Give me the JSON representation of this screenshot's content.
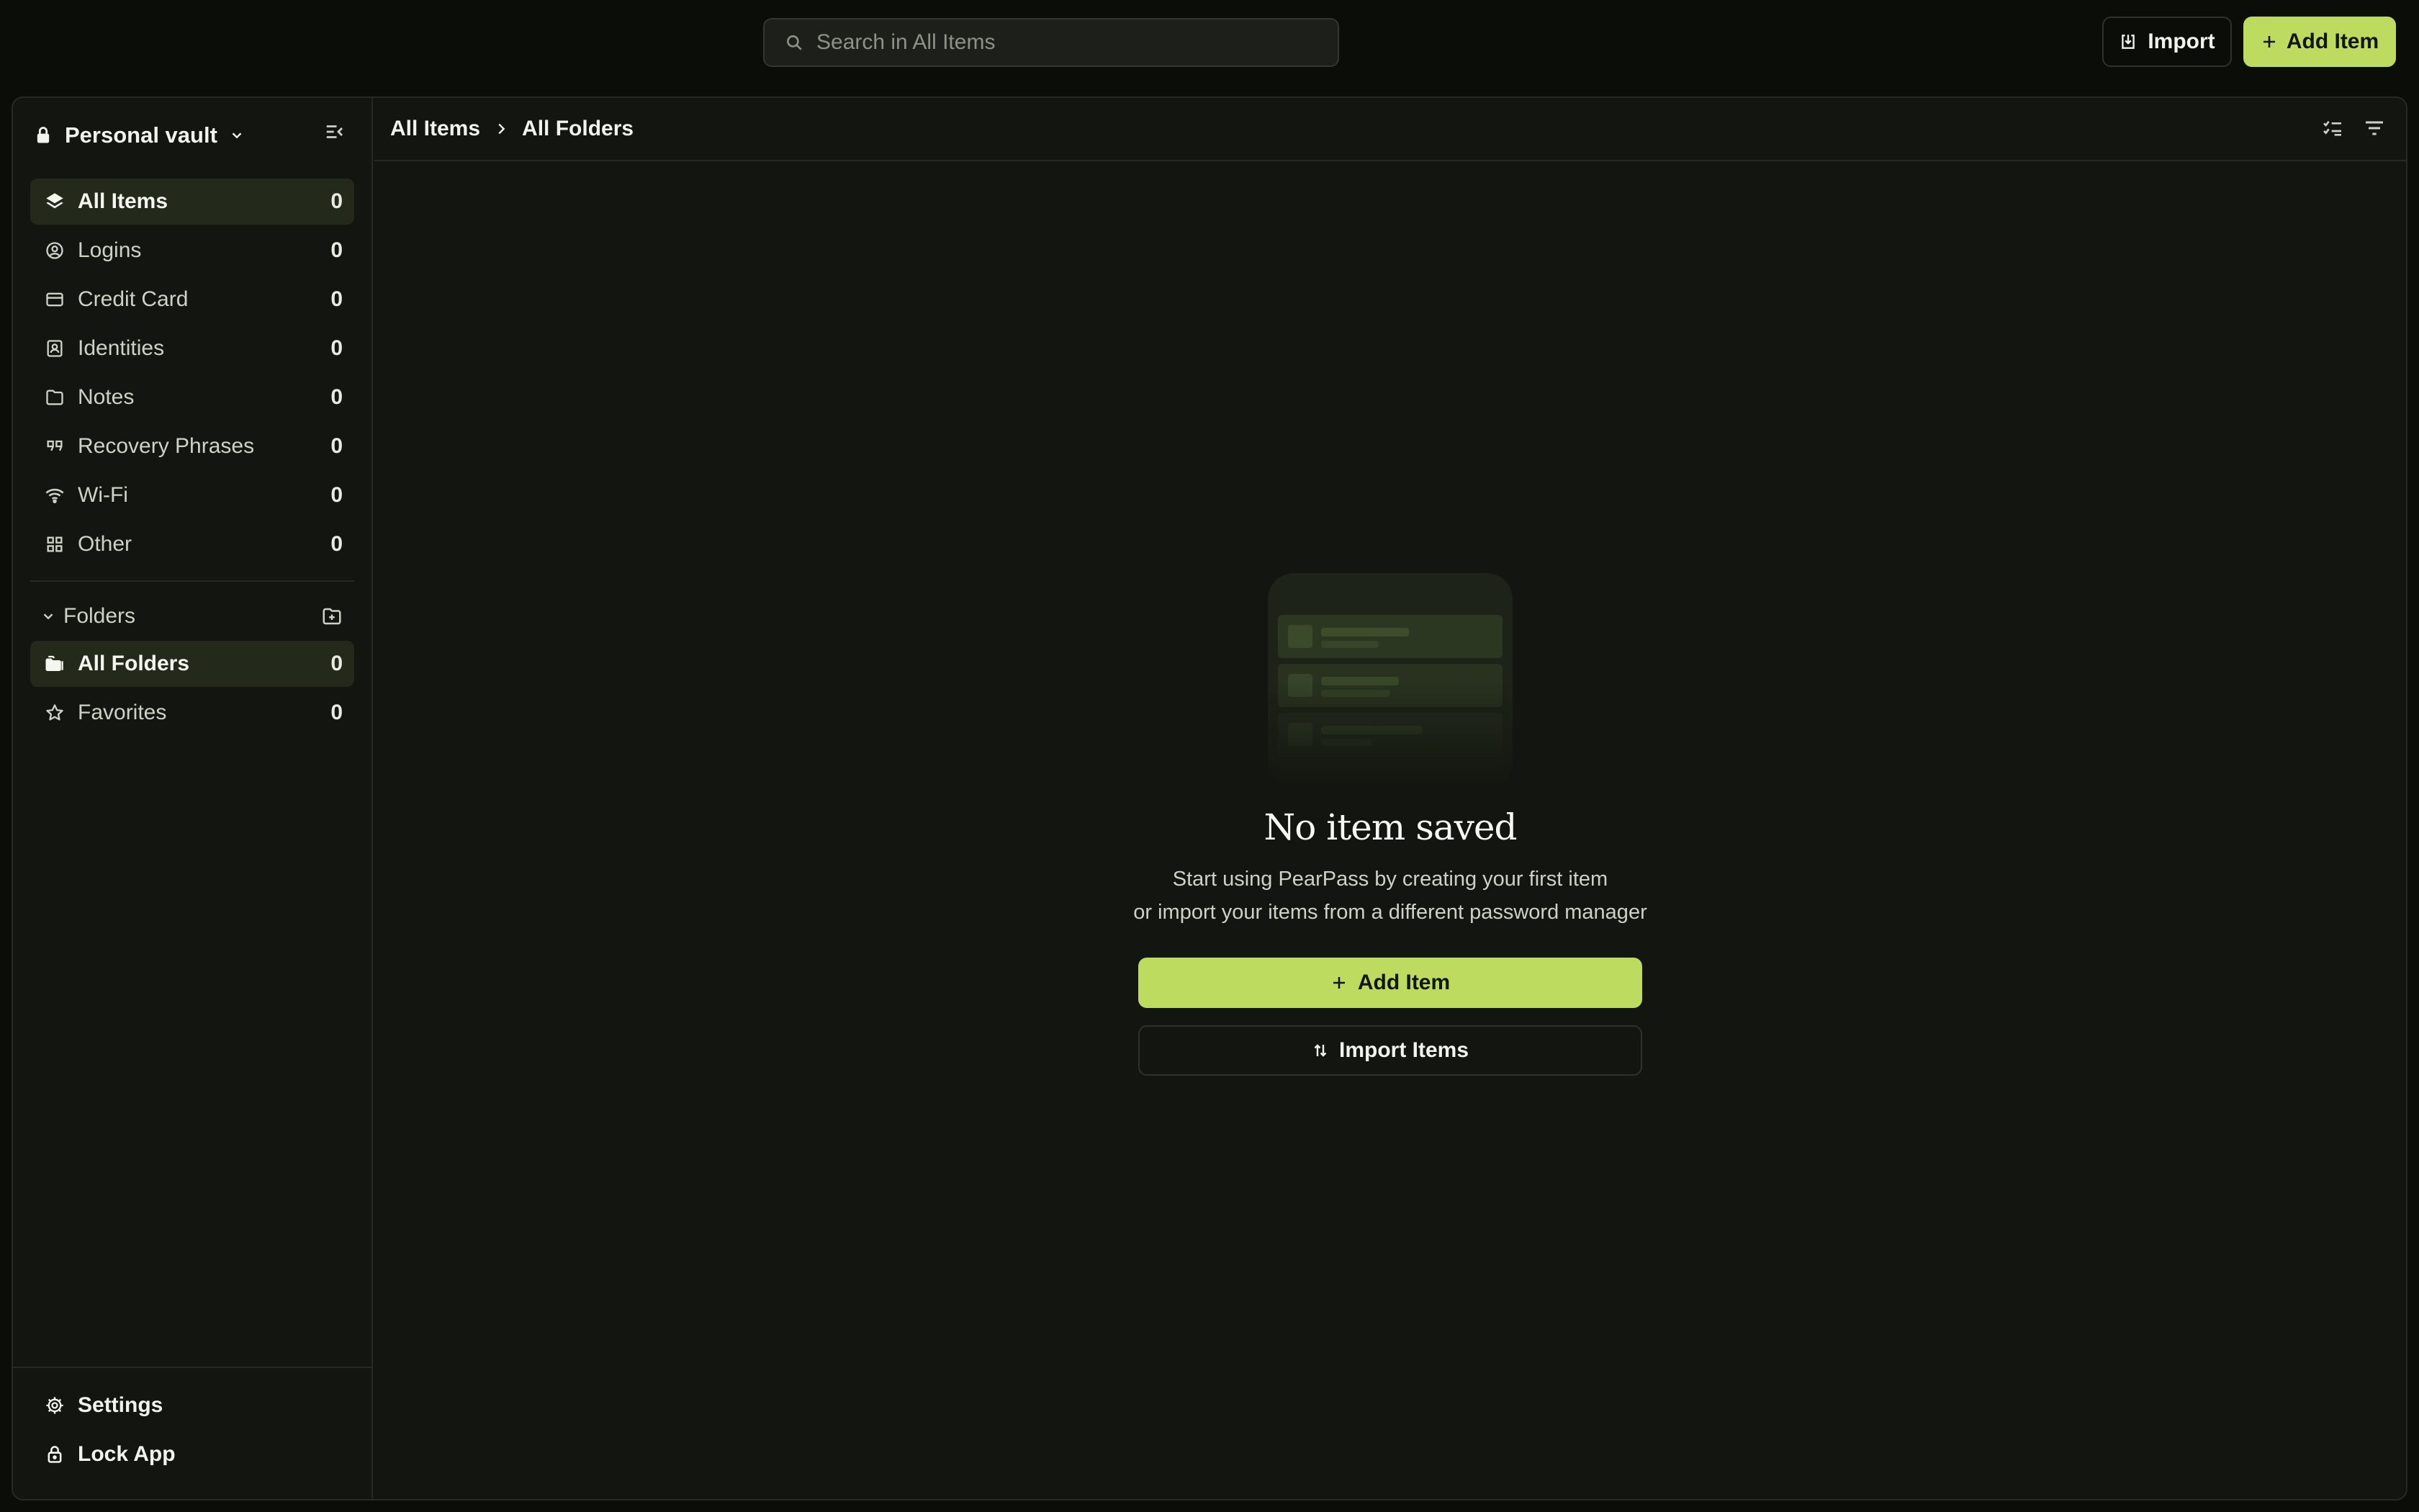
{
  "search": {
    "placeholder": "Search in All Items"
  },
  "header": {
    "import_label": "Import",
    "add_label": "Add Item"
  },
  "sidebar": {
    "vault_name": "Personal vault",
    "items": [
      {
        "label": "All Items",
        "count": "0",
        "icon": "layers-icon"
      },
      {
        "label": "Logins",
        "count": "0",
        "icon": "user-circle-icon"
      },
      {
        "label": "Credit Card",
        "count": "0",
        "icon": "credit-card-icon"
      },
      {
        "label": "Identities",
        "count": "0",
        "icon": "id-badge-icon"
      },
      {
        "label": "Notes",
        "count": "0",
        "icon": "note-icon"
      },
      {
        "label": "Recovery Phrases",
        "count": "0",
        "icon": "quote-icon"
      },
      {
        "label": "Wi-Fi",
        "count": "0",
        "icon": "wifi-icon"
      },
      {
        "label": "Other",
        "count": "0",
        "icon": "grid-icon"
      }
    ],
    "folders_label": "Folders",
    "folders": [
      {
        "label": "All Folders",
        "count": "0"
      },
      {
        "label": "Favorites",
        "count": "0"
      }
    ],
    "settings_label": "Settings",
    "lock_label": "Lock App"
  },
  "breadcrumb": {
    "root": "All Items",
    "current": "All Folders"
  },
  "empty_state": {
    "title": "No item saved",
    "line1": "Start using PearPass by creating your first item",
    "line2": "or import your items from a different password manager",
    "add_label": "Add Item",
    "import_label": "Import Items"
  },
  "colors": {
    "accent": "#bddb5f",
    "background": "#0a0d08",
    "panel": "#131610"
  }
}
